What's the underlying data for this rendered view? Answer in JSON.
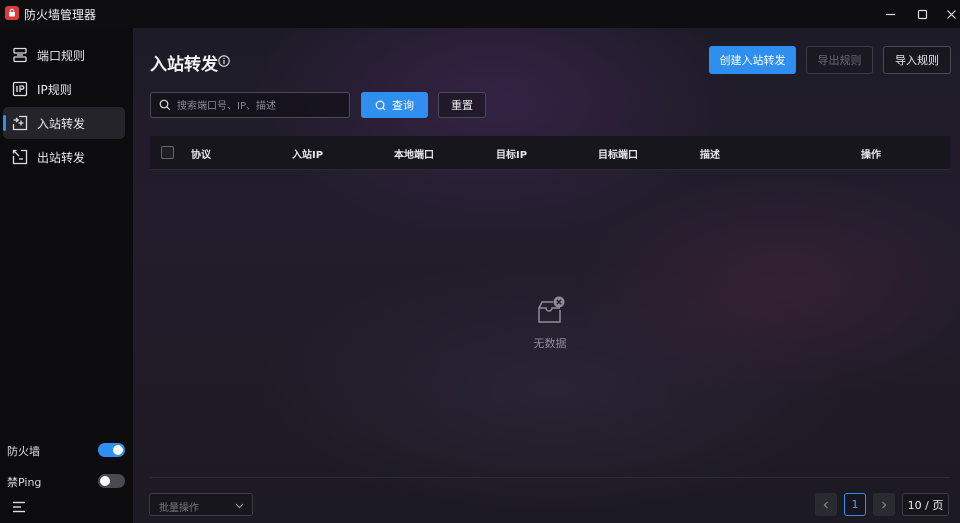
{
  "app": {
    "title": "防火墙管理器"
  },
  "sidebar": {
    "items": [
      {
        "label": "端口规则",
        "icon": "server-icon"
      },
      {
        "label": "IP规则",
        "icon": "ip-icon"
      },
      {
        "label": "入站转发",
        "icon": "inbound-forward-icon",
        "active": true
      },
      {
        "label": "出站转发",
        "icon": "outbound-forward-icon"
      }
    ],
    "toggles": [
      {
        "label": "防火墙",
        "on": true
      },
      {
        "label": "禁Ping",
        "on": false
      }
    ]
  },
  "page": {
    "title": "入站转发",
    "actions": {
      "create": "创建入站转发",
      "export": "导出规则",
      "import": "导入规则"
    },
    "search": {
      "placeholder": "搜索端口号、IP、描述",
      "query_label": "查询",
      "reset_label": "重置"
    },
    "table": {
      "columns": [
        "协议",
        "入站IP",
        "本地端口",
        "目标IP",
        "目标端口",
        "描述",
        "操作"
      ],
      "rows": [],
      "empty_text": "无数据"
    },
    "footer": {
      "batch_label": "批量操作",
      "current_page": "1",
      "page_size": "10 / 页"
    }
  },
  "colors": {
    "accent": "#2f8ff0",
    "app_icon": "#d93a3a",
    "sidebar_bg": "#0c0c0f"
  }
}
